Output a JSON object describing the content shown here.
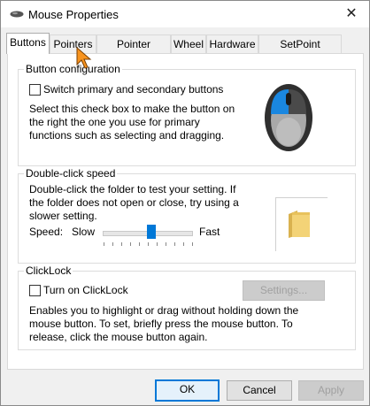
{
  "window": {
    "title": "Mouse Properties",
    "close_glyph": "✕"
  },
  "tabs": [
    {
      "label": "Buttons",
      "active": true
    },
    {
      "label": "Pointers"
    },
    {
      "label": "Pointer Options"
    },
    {
      "label": "Wheel"
    },
    {
      "label": "Hardware"
    },
    {
      "label": "SetPoint Settings"
    }
  ],
  "button_config": {
    "title": "Button configuration",
    "checkbox_label": "Switch primary and secondary buttons",
    "checked": false,
    "description": "Select this check box to make the button on the right the one you use for primary functions such as selecting and dragging."
  },
  "double_click": {
    "title": "Double-click speed",
    "description": "Double-click the folder to test your setting. If the folder does not open or close, try using a slower setting.",
    "speed_label": "Speed:",
    "slow_label": "Slow",
    "fast_label": "Fast",
    "speed_value": 0.55
  },
  "clicklock": {
    "title": "ClickLock",
    "checkbox_label": "Turn on ClickLock",
    "checked": false,
    "settings_button": "Settings...",
    "description": "Enables you to highlight or drag without holding down the mouse button. To set, briefly press the mouse button. To release, click the mouse button again."
  },
  "footer": {
    "ok": "OK",
    "cancel": "Cancel",
    "apply": "Apply"
  },
  "colors": {
    "accent": "#0078d7",
    "cursor": "#f7931e",
    "folder": "#f3d377"
  },
  "icons": {
    "mouse": "mouse-icon",
    "folder": "folder-icon",
    "cursor": "cursor-arrow-icon"
  }
}
